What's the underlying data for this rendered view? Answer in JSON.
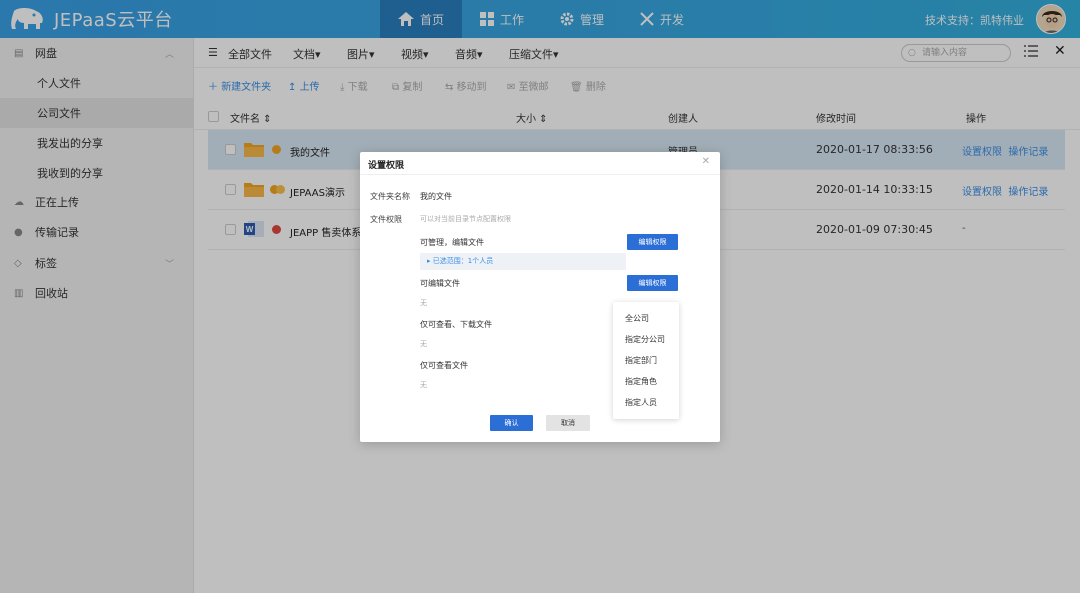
{
  "header": {
    "logo_text": "JEPaaS云平台",
    "nav": [
      {
        "label": "首页",
        "icon": "home-icon"
      },
      {
        "label": "工作",
        "icon": "grid-icon"
      },
      {
        "label": "管理",
        "icon": "gear-icon"
      },
      {
        "label": "开发",
        "icon": "tools-icon"
      }
    ],
    "support": "技术支持：凯特伟业"
  },
  "sidebar": {
    "items": [
      {
        "label": "网盘",
        "icon": "disk-icon"
      },
      {
        "label": "个人文件"
      },
      {
        "label": "公司文件"
      },
      {
        "label": "我发出的分享"
      },
      {
        "label": "我收到的分享"
      },
      {
        "label": "正在上传",
        "icon": "cloud-icon"
      },
      {
        "label": "传输记录",
        "icon": "transfer-icon"
      },
      {
        "label": "标签",
        "icon": "tag-icon"
      },
      {
        "label": "回收站",
        "icon": "trash-icon"
      }
    ]
  },
  "main": {
    "tabs": [
      "全部文件",
      "文档",
      "图片",
      "视频",
      "音频",
      "压缩文件"
    ],
    "search_placeholder": "请输入内容",
    "toolbar": [
      "新建文件夹",
      "上传",
      "下载",
      "复制",
      "移动到",
      "至微邮",
      "删除"
    ],
    "columns": {
      "name": "文件名",
      "size": "大小",
      "creator": "创建人",
      "modified": "修改时间",
      "ops": "操作"
    },
    "rows": [
      {
        "name": "我的文件",
        "creator": "管理员",
        "modified": "2020-01-17 08:33:56",
        "op1": "设置权限",
        "op2": "操作记录"
      },
      {
        "name": "JEPAAS演示",
        "creator": "",
        "modified": "2020-01-14 10:33:15",
        "op1": "设置权限",
        "op2": "操作记录"
      },
      {
        "name": "JEAPP 售卖体系说",
        "creator": "",
        "modified": "2020-01-09 07:30:45",
        "op1": "-",
        "op2": ""
      }
    ]
  },
  "modal": {
    "title": "设置权限",
    "folder_name_label": "文件夹名称",
    "folder_name": "我的文件",
    "perm_label": "文件权限",
    "perm_hint": "可以对当前目录节点配置权限",
    "sections": [
      {
        "title": "可管理，编辑文件",
        "value": "已选范围：1个人员"
      },
      {
        "title": "可编辑文件",
        "value": "无"
      },
      {
        "title": "仅可查看、下载文件",
        "value": "无"
      },
      {
        "title": "仅可查看文件",
        "value": "无"
      }
    ],
    "edit_btn": "编辑权限",
    "ok": "确认",
    "cancel": "取消"
  },
  "dropdown": [
    "全公司",
    "指定分公司",
    "指定部门",
    "指定角色",
    "指定人员"
  ]
}
